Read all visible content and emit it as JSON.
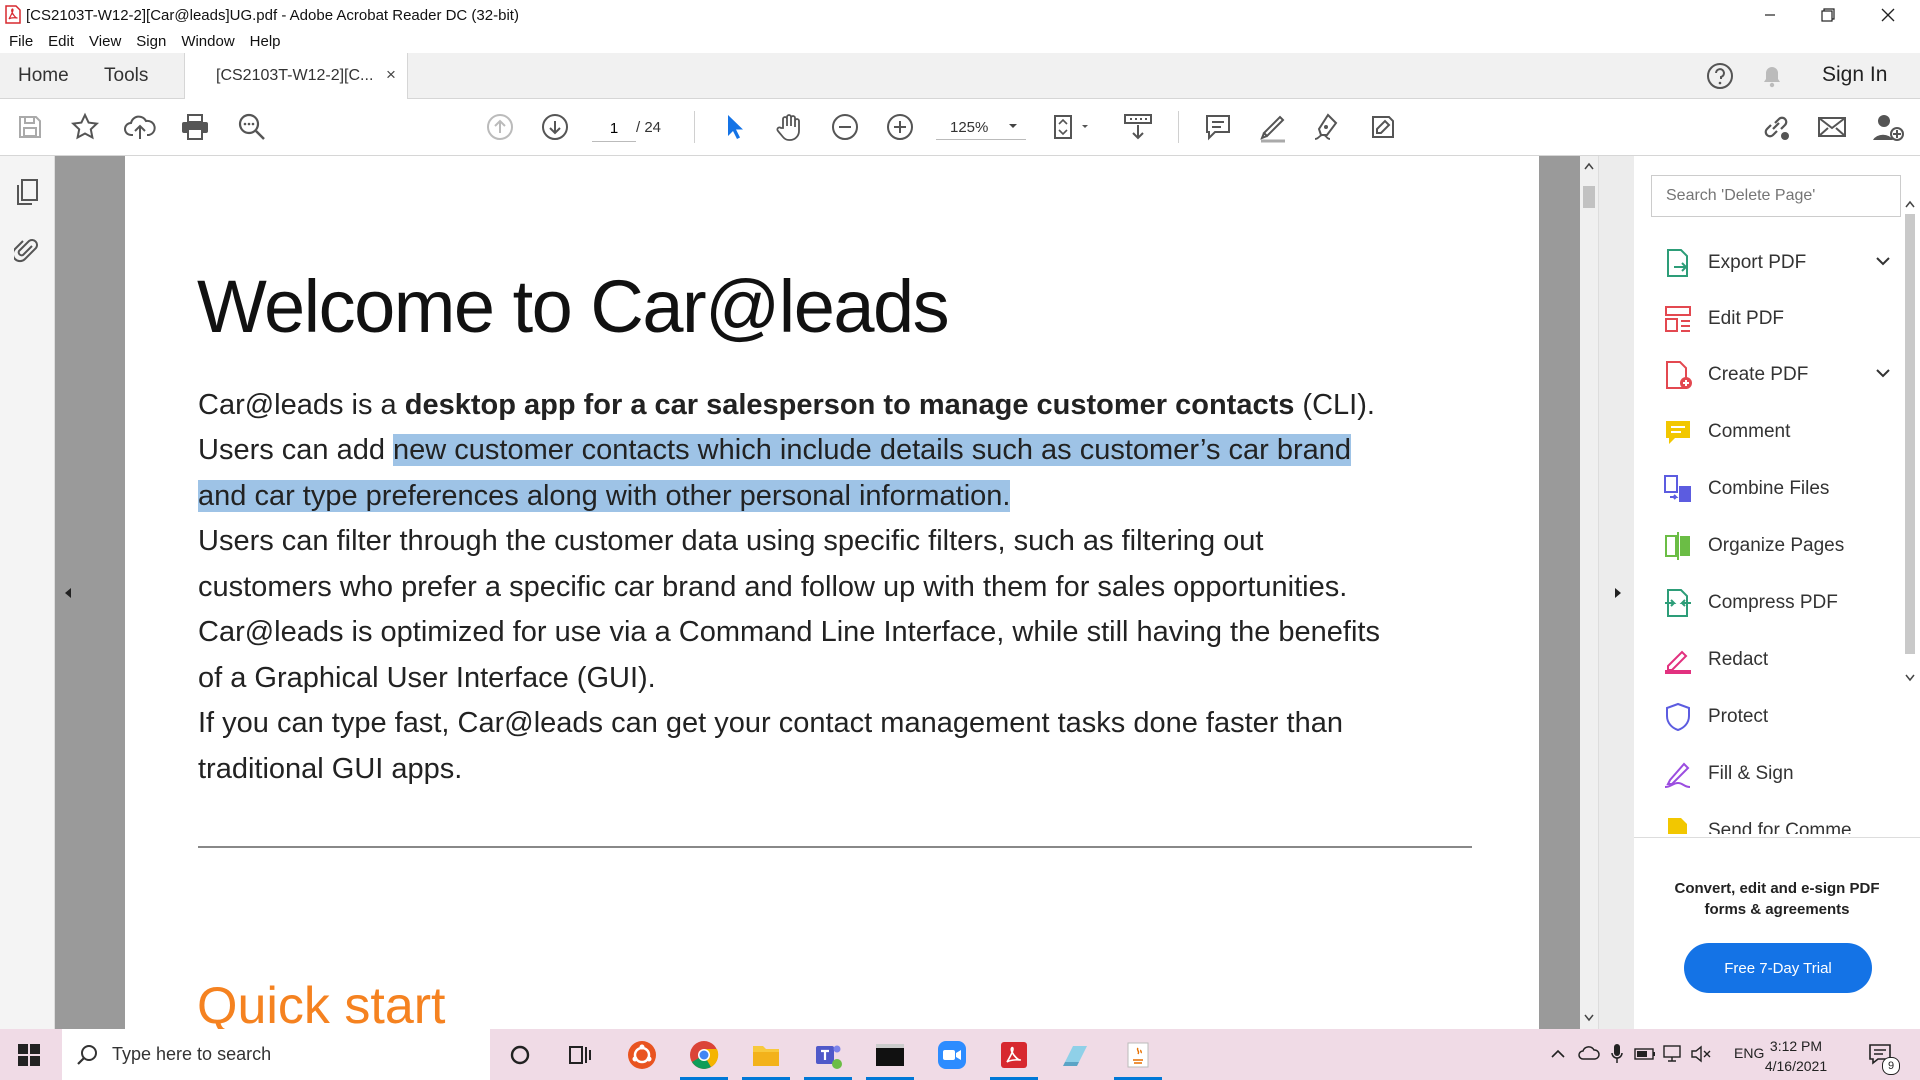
{
  "window": {
    "title": "[CS2103T-W12-2][Car@leads]UG.pdf - Adobe Acrobat Reader DC (32-bit)"
  },
  "menu": [
    "File",
    "Edit",
    "View",
    "Sign",
    "Window",
    "Help"
  ],
  "tabs": {
    "home": "Home",
    "tools": "Tools",
    "document": "[CS2103T-W12-2][C...",
    "close": "×",
    "sign_in": "Sign In"
  },
  "toolbar": {
    "page_current": "1",
    "page_total": "/ 24",
    "zoom": "125%"
  },
  "document": {
    "heading": "Welcome to Car@leads",
    "para1": {
      "pre": "Car@leads is a ",
      "bold": "desktop app for a car salesperson to manage customer contacts",
      "post": " (CLI)."
    },
    "line2_pre": "Users can add ",
    "line2_hl": "new customer contacts which include details such as customer’s car brand",
    "line3_hl": "and car type preferences along with other personal information.",
    "line4": "Users can filter through the customer data using specific filters, such as filtering out",
    "line5": "customers who prefer a specific car brand and follow up with them for sales opportunities.",
    "line6": "Car@leads is optimized for use via a Command Line Interface, while still having the benefits",
    "line7": "of a Graphical User Interface (GUI).",
    "line8": "If you can type fast, Car@leads can get your contact management tasks done faster than",
    "line9": "traditional GUI apps.",
    "heading2": "Quick start",
    "highlight_color": "#9ec3e6",
    "heading2_color": "#f58220"
  },
  "right_pane": {
    "search_placeholder": "Search 'Delete Page'",
    "tools": [
      {
        "label": "Export PDF",
        "icon": "export-pdf-icon",
        "color": "#2d9d78",
        "expandable": true
      },
      {
        "label": "Edit PDF",
        "icon": "edit-pdf-icon",
        "color": "#e34850",
        "expandable": false
      },
      {
        "label": "Create PDF",
        "icon": "create-pdf-icon",
        "color": "#e34850",
        "expandable": true
      },
      {
        "label": "Comment",
        "icon": "comment-icon",
        "color": "#f2c700",
        "expandable": false
      },
      {
        "label": "Combine Files",
        "icon": "combine-files-icon",
        "color": "#5c5ce0",
        "expandable": false
      },
      {
        "label": "Organize Pages",
        "icon": "organize-pages-icon",
        "color": "#6bbd45",
        "expandable": false
      },
      {
        "label": "Compress PDF",
        "icon": "compress-pdf-icon",
        "color": "#2d9d78",
        "expandable": false
      },
      {
        "label": "Redact",
        "icon": "redact-icon",
        "color": "#e2317f",
        "expandable": false
      },
      {
        "label": "Protect",
        "icon": "protect-icon",
        "color": "#5c5ce0",
        "expandable": false
      },
      {
        "label": "Fill & Sign",
        "icon": "fill-sign-icon",
        "color": "#9b4de0",
        "expandable": false
      },
      {
        "label": "Send for Comme",
        "icon": "send-comment-icon",
        "color": "#f2c700",
        "expandable": false
      }
    ],
    "promo": "Convert, edit and e-sign PDF forms & agreements",
    "trial_button": "Free 7-Day Trial"
  },
  "taskbar": {
    "search_placeholder": "Type here to search",
    "language": "ENG",
    "time": "3:12 PM",
    "date": "4/16/2021",
    "notifications": "9"
  },
  "colors": {
    "acrobat_red": "#d7282f",
    "accent_blue": "#1473e6",
    "taskbar_bg": "#f0dbe6"
  }
}
